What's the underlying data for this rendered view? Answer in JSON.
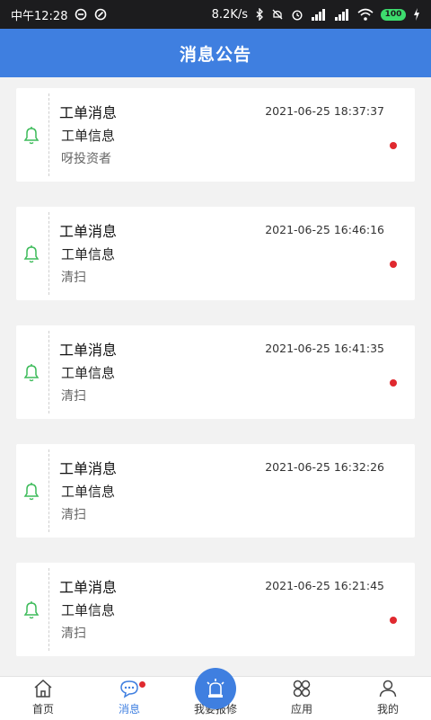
{
  "status_bar": {
    "time": "中午12:28",
    "network_speed": "8.2K/s",
    "battery": "100"
  },
  "header": {
    "title": "消息公告"
  },
  "messages": [
    {
      "title": "工单消息",
      "time": "2021-06-25 18:37:37",
      "subtitle": "工单信息",
      "desc": "呀投资者"
    },
    {
      "title": "工单消息",
      "time": "2021-06-25 16:46:16",
      "subtitle": "工单信息",
      "desc": "清扫"
    },
    {
      "title": "工单消息",
      "time": "2021-06-25 16:41:35",
      "subtitle": "工单信息",
      "desc": "清扫"
    },
    {
      "title": "工单消息",
      "time": "2021-06-25 16:32:26",
      "subtitle": "工单信息",
      "desc": "清扫"
    },
    {
      "title": "工单消息",
      "time": "2021-06-25 16:21:45",
      "subtitle": "工单信息",
      "desc": "清扫"
    }
  ],
  "tabbar": {
    "home": "首页",
    "messages": "消息",
    "repair": "我要报修",
    "apps": "应用",
    "mine": "我的"
  },
  "colors": {
    "accent": "#3f7fe0",
    "badge": "#e0292f",
    "bell": "#3dbb5a"
  }
}
